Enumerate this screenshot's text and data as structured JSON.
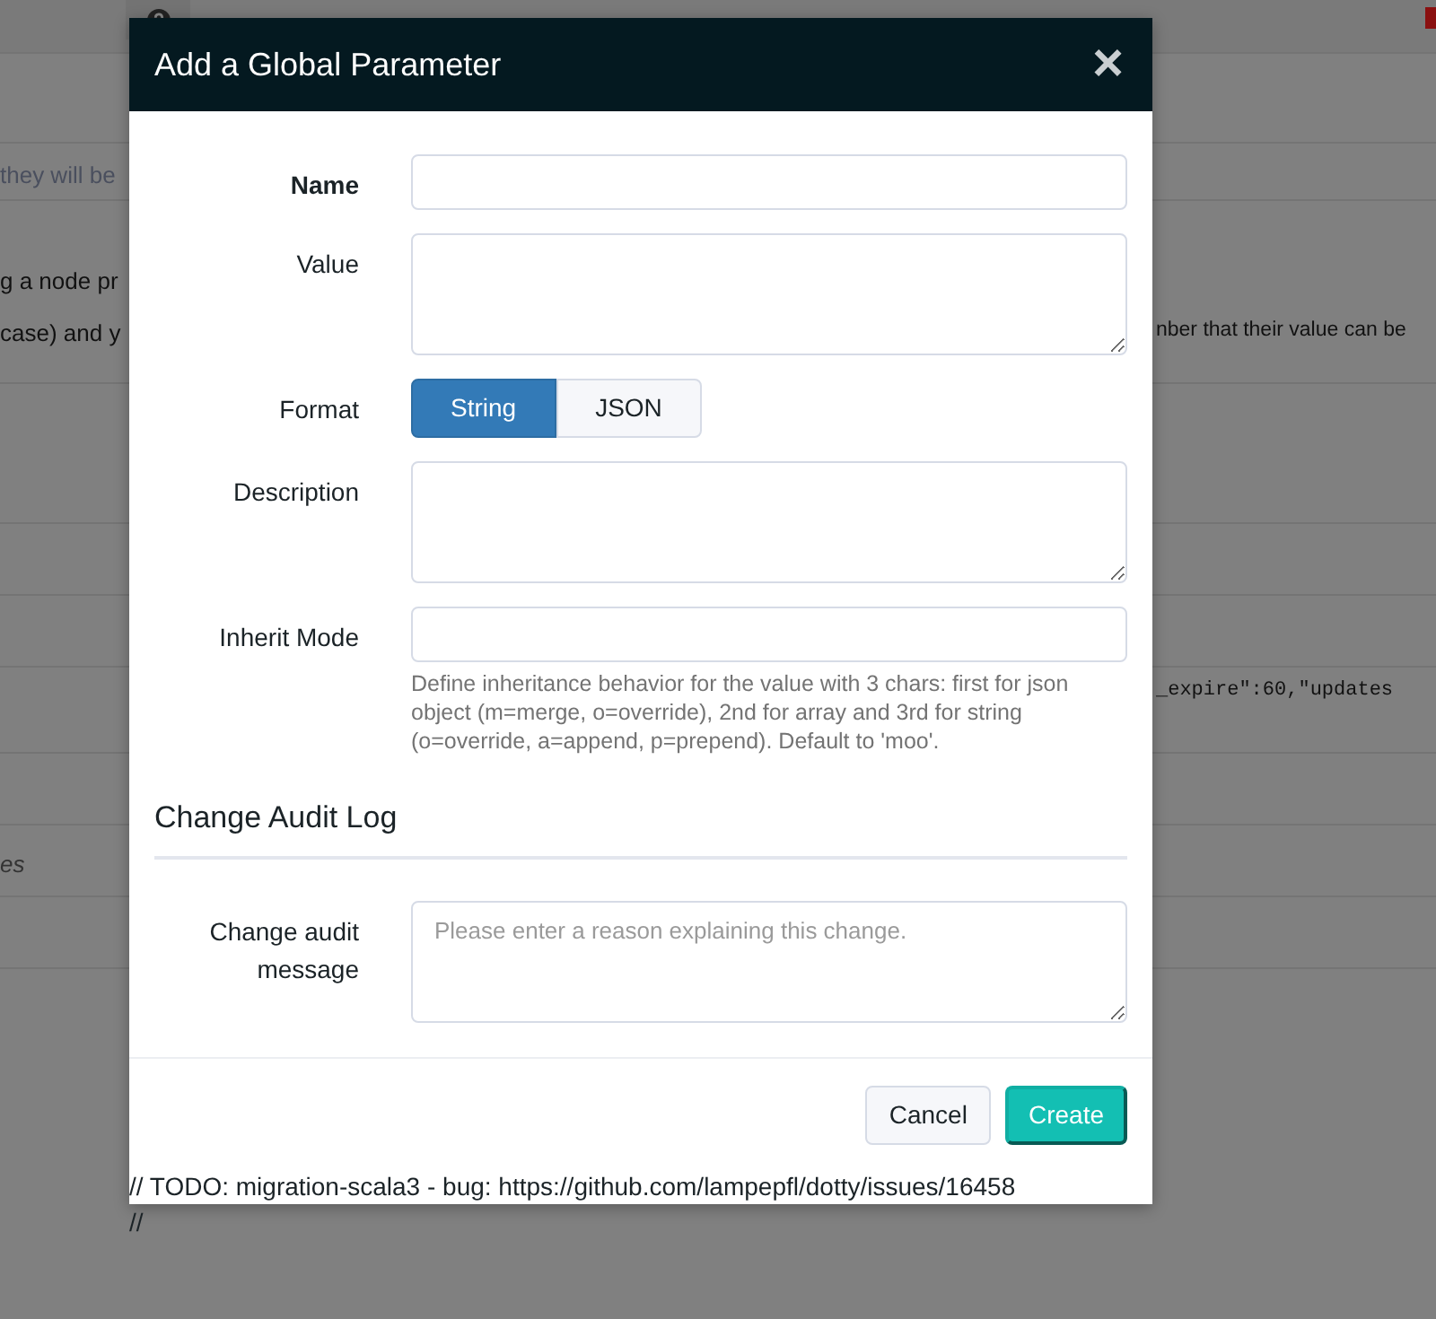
{
  "background_page": {
    "rows": [
      {
        "lines": []
      },
      {
        "lines": [
          {
            "left": "they will be"
          }
        ]
      },
      {
        "lines": [
          {
            "left": "g a node pr"
          },
          {
            "left": "case) and y",
            "right": "nber that their value can be"
          }
        ]
      },
      {
        "lines": []
      },
      {
        "lines": []
      },
      {
        "lines": []
      },
      {
        "lines": [
          {
            "right": "_expire\":60,\"updates"
          }
        ]
      },
      {
        "lines": []
      },
      {
        "lines": [
          {
            "left": "es"
          }
        ]
      },
      {
        "lines": []
      }
    ]
  },
  "modal": {
    "title": "Add a Global Parameter",
    "close": "×",
    "fields": [
      {
        "kind": "input",
        "label": "Name",
        "required": true
      },
      {
        "kind": "textarea",
        "label": "Value",
        "required": false
      },
      {
        "kind": "toggle",
        "label": "Format",
        "required": false,
        "options": [
          {
            "label": "String",
            "selected": true
          },
          {
            "label": "JSON",
            "selected": false
          }
        ]
      },
      {
        "kind": "textarea",
        "label": "Description",
        "required": false
      },
      {
        "kind": "input",
        "label": "Inherit Mode",
        "required": false,
        "help": "Define inheritance behavior for the value with 3 chars: first for json object (m=merge, o=override), 2nd for array and 3rd for string (o=override, a=append, p=prepend). Default to 'moo'."
      }
    ],
    "audit": {
      "title": "Change Audit Log",
      "label": "Change audit message",
      "placeholder": "Please enter a reason explaining this change."
    },
    "buttons": [
      {
        "label": "Cancel",
        "kind": "secondary"
      },
      {
        "label": "Create",
        "kind": "primary"
      }
    ],
    "footnote_lines": [
      "// TODO: migration-scala3 - bug: https://github.com/lampepfl/dotty/issues/16458",
      "//"
    ]
  }
}
